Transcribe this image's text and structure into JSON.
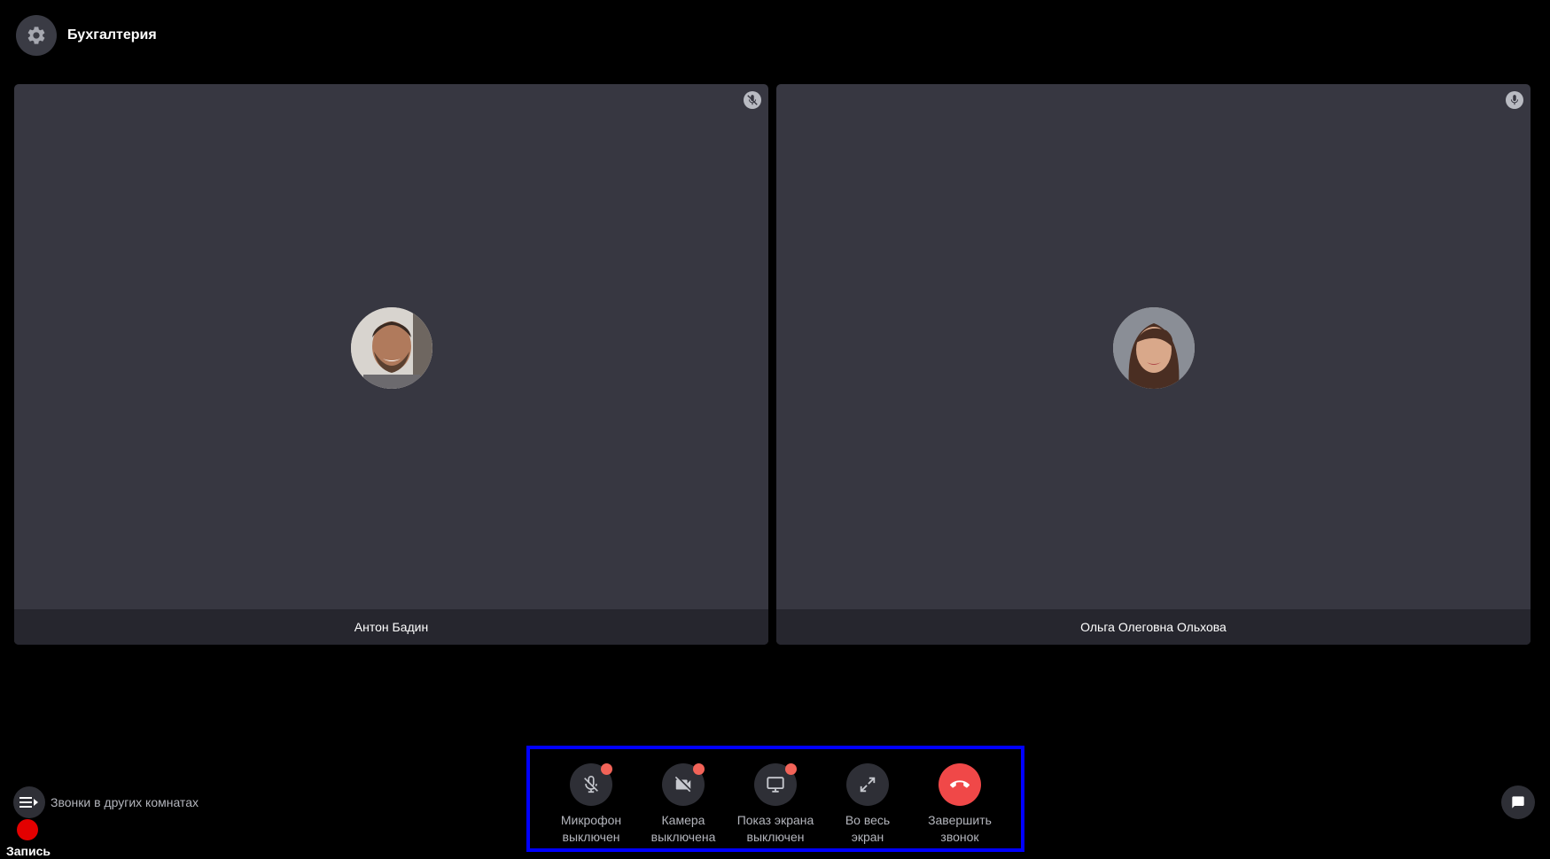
{
  "header": {
    "room_title": "Бухгалтерия"
  },
  "participants": [
    {
      "name": "Антон Бадин",
      "mic_state": "muted"
    },
    {
      "name": "Ольга Олеговна Ольхова",
      "mic_state": "on"
    }
  ],
  "bottom_left": {
    "other_rooms_label": "Звонки в других комнатах",
    "record_label": "Запись"
  },
  "controls": [
    {
      "line1": "Микрофон",
      "line2": "выключен",
      "icon": "mic-off-icon",
      "badge": true
    },
    {
      "line1": "Камера",
      "line2": "выключена",
      "icon": "camera-off-icon",
      "badge": true
    },
    {
      "line1": "Показ экрана",
      "line2": "выключен",
      "icon": "monitor-icon",
      "badge": true
    },
    {
      "line1": "Во весь",
      "line2": "экран",
      "icon": "expand-icon",
      "badge": false
    },
    {
      "line1": "Завершить",
      "line2": "звонок",
      "icon": "hangup-icon",
      "badge": false
    }
  ],
  "colors": {
    "background": "#000000",
    "tile": "#373741",
    "name_bar": "#26262e",
    "button": "#2e2f36",
    "hangup": "#f04848",
    "badge": "#f26358",
    "record": "#e30000",
    "highlight_border": "#0000ff"
  }
}
